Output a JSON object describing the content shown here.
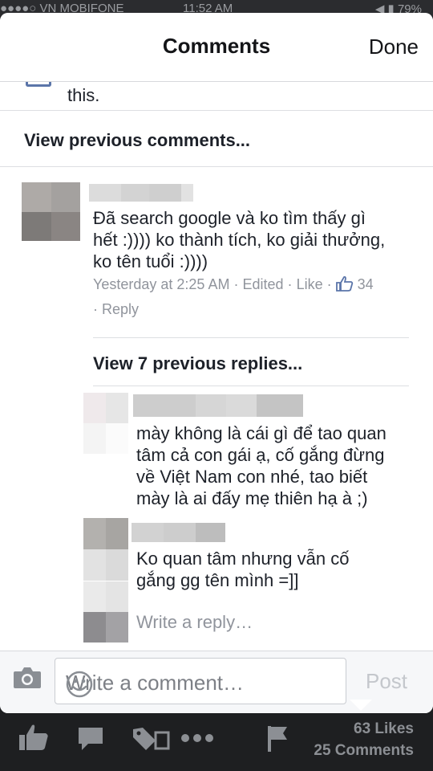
{
  "status_bar": {
    "carrier": "●●●●○ VN MOBIFONE",
    "time": "11:52 AM",
    "battery": "◀ ▮ 79%"
  },
  "header": {
    "title": "Comments",
    "done_label": "Done"
  },
  "partial_comment": {
    "text": "this."
  },
  "view_previous_comments": "View previous comments...",
  "comment": {
    "text": "Đã search google và ko tìm thấy gì hết :)))) ko thành tích, ko giải thưởng, ko tên tuổi :))))",
    "line1": "Đã search google và ko tìm thấy gì",
    "line2": "hết :)))) ko thành tích, ko giải thưởng,",
    "line3": "ko tên tuổi :))))",
    "timestamp": "Yesterday at 2:25 AM",
    "edited": "Edited",
    "like": "Like",
    "like_count": "34",
    "reply": "Reply",
    "sep": "·"
  },
  "view_previous_replies": "View 7 previous replies...",
  "replies": [
    {
      "text": "mày không là cái gì để tao quan tâm cả con gái ạ, cố gắng đừng về Việt Nam con nhé, tao biết mày là ai đấy mẹ thiên hạ à ;)",
      "lines": [
        "mày không là cái gì để tao quan",
        "tâm cả con gái ạ, cố gắng đừng",
        "về Việt Nam con nhé, tao biết",
        "mày là ai đấy mẹ thiên hạ à ;)"
      ]
    },
    {
      "text": "Ko quan tâm nhưng vẫn cố gắng gg tên mình =]]",
      "lines": [
        "Ko quan tâm nhưng vẫn cố",
        "gắng gg tên mình =]]"
      ]
    }
  ],
  "write_reply_placeholder": "Write a reply…",
  "composer": {
    "placeholder": "Write a comment…",
    "post_label": "Post"
  },
  "bottom_bar": {
    "likes": "63 Likes",
    "comments": "25 Comments"
  },
  "icons": [
    "camera-icon",
    "smiley-icon",
    "like-icon",
    "comment-icon",
    "tag-icon",
    "more-icon",
    "report-flag-icon"
  ],
  "colors": {
    "accent": "#5b75a9",
    "meta": "#90949c",
    "bar": "#1e1f21"
  }
}
